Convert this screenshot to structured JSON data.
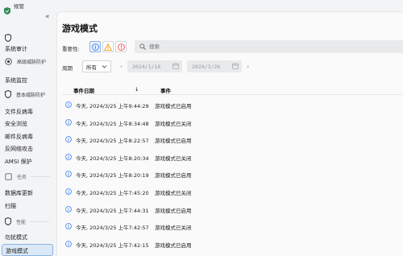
{
  "app": {
    "title": "规管",
    "icon": "app-shield-icon",
    "accent": "#2e8b57"
  },
  "sidebar": {
    "collapse_icon": "double-chevron-left-icon",
    "items": [
      {
        "label": "系统审计"
      },
      {
        "label": "高级威胁防护"
      },
      {
        "label": "系统监控"
      },
      {
        "label": "基本威胁防护"
      },
      {
        "label": "文件反病毒"
      },
      {
        "label": "安全浏览"
      },
      {
        "label": "邮件反病毒"
      },
      {
        "label": "反网络攻击"
      },
      {
        "label": "AMSI 保护"
      },
      {
        "label": "任务"
      },
      {
        "label": "数据库更新"
      },
      {
        "label": "扫描"
      },
      {
        "label": "性能"
      },
      {
        "label": "勿扰模式"
      },
      {
        "label": "游戏模式"
      }
    ],
    "active_item": "游戏模式",
    "active_color": "#dbe9f7"
  },
  "main": {
    "title": "游戏模式",
    "filters": {
      "severity_label": "重要性:",
      "severity_buttons": [
        {
          "icon": "info-icon",
          "color": "#3b82f6"
        },
        {
          "icon": "warning-icon",
          "color": "#f59e0b"
        },
        {
          "icon": "error-icon",
          "color": "#ef4444"
        }
      ],
      "search_placeholder": "搜索",
      "period_label": "周期",
      "period_value": "所有",
      "date_from": "2024/1/18",
      "date_to": "2024/3/26"
    },
    "table": {
      "columns": [
        "事件日期",
        "事件"
      ],
      "sort_icon": "arrow-down-icon",
      "rows": [
        {
          "date": "今天, 2024/3/25 上午9:44:29",
          "event": "游戏模式已启用"
        },
        {
          "date": "今天, 2024/3/25 上午8:34:48",
          "event": "游戏模式已关闭"
        },
        {
          "date": "今天, 2024/3/25 上午8:22:57",
          "event": "游戏模式已启用"
        },
        {
          "date": "今天, 2024/3/25 上午8:20:34",
          "event": "游戏模式已关闭"
        },
        {
          "date": "今天, 2024/3/25 上午8:20:19",
          "event": "游戏模式已启用"
        },
        {
          "date": "今天, 2024/3/25 上午7:45:20",
          "event": "游戏模式已关闭"
        },
        {
          "date": "今天, 2024/3/25 上午7:44:31",
          "event": "游戏模式已启用"
        },
        {
          "date": "今天, 2024/3/25 上午7:42:57",
          "event": "游戏模式已关闭"
        },
        {
          "date": "今天, 2024/3/25 上午7:42:15",
          "event": "游戏模式已启用"
        }
      ]
    }
  }
}
